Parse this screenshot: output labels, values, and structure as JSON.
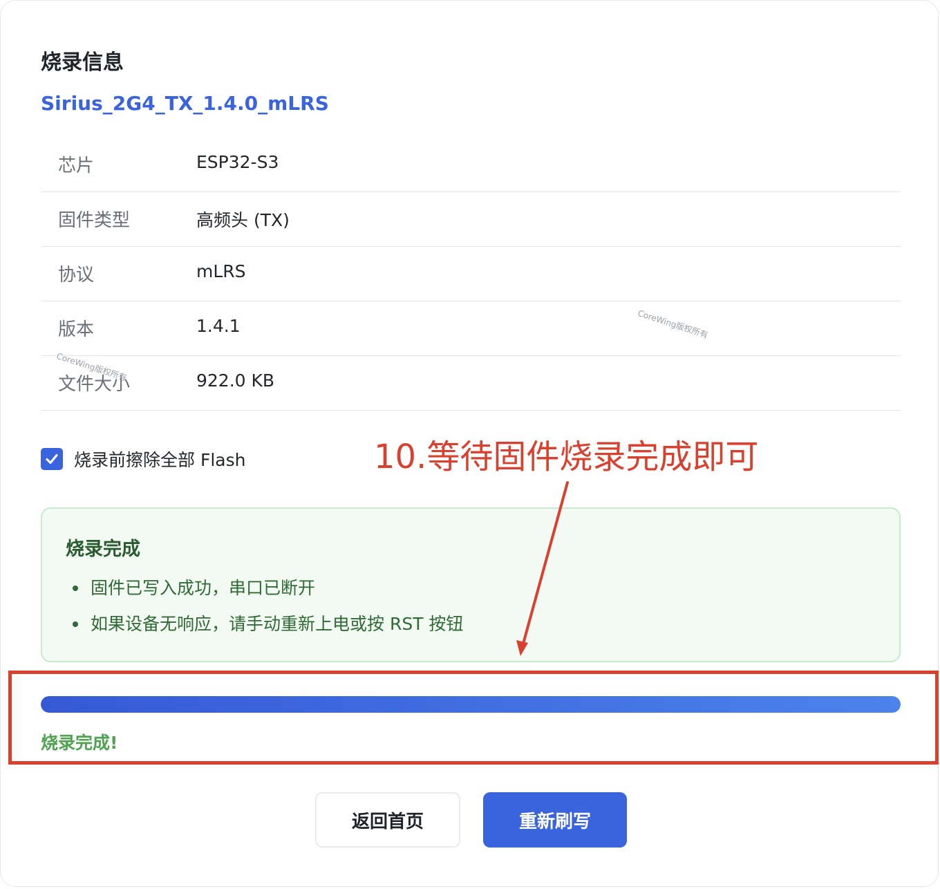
{
  "section_title": "烧录信息",
  "firmware_name": "Sirius_2G4_TX_1.4.0_mLRS",
  "info_rows": [
    {
      "label": "芯片",
      "value": "ESP32-S3"
    },
    {
      "label": "固件类型",
      "value": "高频头 (TX)"
    },
    {
      "label": "协议",
      "value": "mLRS"
    },
    {
      "label": "版本",
      "value": "1.4.1"
    },
    {
      "label": "文件大小",
      "value": "922.0 KB"
    }
  ],
  "watermark_text": "CoreWing版权所有",
  "erase_option": {
    "label": "烧录前擦除全部 Flash",
    "checked": true
  },
  "annotation": {
    "text": "10.等待固件烧录完成即可",
    "color": "#d9412e"
  },
  "success_box": {
    "title": "烧录完成",
    "items": [
      "固件已写入成功，串口已断开",
      "如果设备无响应，请手动重新上电或按 RST 按钮"
    ]
  },
  "progress": {
    "value_percent": 100,
    "status_text": "烧录完成!"
  },
  "buttons": {
    "home_label": "返回首页",
    "reflash_label": "重新刷写"
  },
  "colors": {
    "accent": "#3a63de",
    "success_text": "#4fa24f",
    "annotation_red": "#d9412e"
  }
}
